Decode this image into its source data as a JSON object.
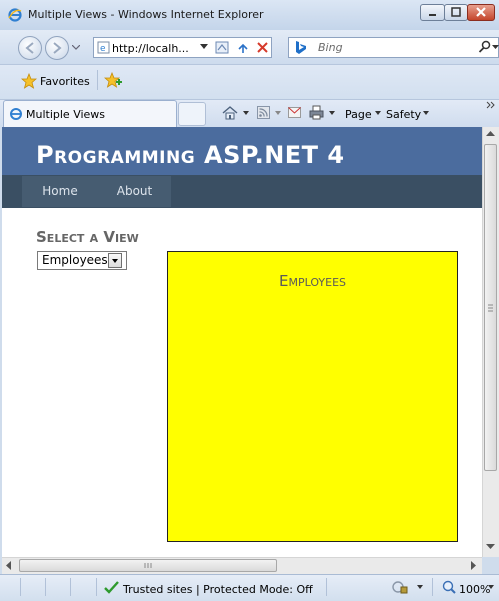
{
  "window": {
    "title": "Multiple Views - Windows Internet Explorer"
  },
  "address_bar": {
    "url": "http://localh...",
    "search_placeholder": "Bing"
  },
  "favorites_bar": {
    "favorites_label": "Favorites"
  },
  "tab": {
    "label": "Multiple Views"
  },
  "command_bar": {
    "page_label": "Page",
    "safety_label": "Safety"
  },
  "page": {
    "site_title": "Programming ASP.NET 4",
    "menu": [
      "Home",
      "About"
    ],
    "select_heading": "Select a View",
    "select_value": "Employees",
    "panel_title": "Employees",
    "panel_color": "#ffff00"
  },
  "status_bar": {
    "zone_text": "Trusted sites | Protected Mode: Off",
    "zoom": "100%"
  },
  "colors": {
    "header": "#4b6c9e",
    "menu_bar": "#3a4f63",
    "panel": "#ffff00"
  }
}
